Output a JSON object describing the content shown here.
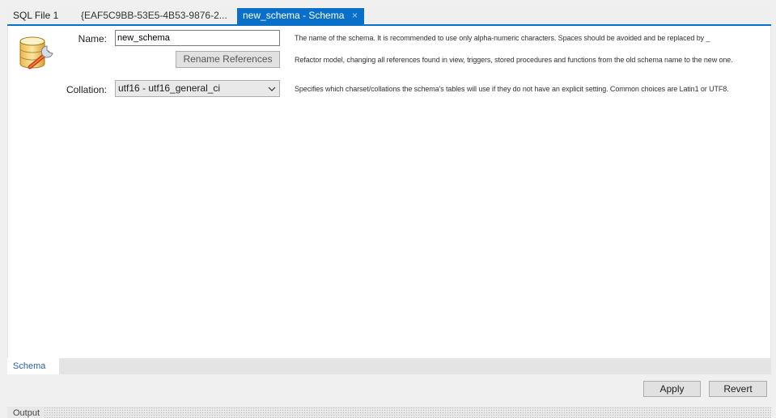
{
  "tabs": [
    {
      "label": "SQL File 1"
    },
    {
      "label": "{EAF5C9BB-53E5-4B53-9876-2..."
    },
    {
      "label": "new_schema - Schema",
      "active": true,
      "close_glyph": "×"
    }
  ],
  "schema_icon": "database-wrench-icon",
  "form": {
    "name_label": "Name:",
    "name_value": "new_schema",
    "name_hint": "The name of the schema. It is recommended to use only alpha-numeric characters. Spaces should be avoided and be replaced by _",
    "rename_button": "Rename References",
    "rename_hint": "Refactor model, changing all references found in view, triggers, stored procedures and functions from the old schema name to the new one.",
    "collation_label": "Collation:",
    "collation_value": "utf16 - utf16_general_ci",
    "collation_hint": "Specifies which charset/collations the schema's tables will use if they do not have an explicit setting. Common choices are Latin1 or UTF8."
  },
  "subtabs": [
    {
      "label": "Schema"
    }
  ],
  "actions": {
    "apply": "Apply",
    "revert": "Revert"
  },
  "output": {
    "label": "Output"
  },
  "colors": {
    "accent": "#0a6fc8",
    "subtab_text": "#2a5fa5"
  }
}
